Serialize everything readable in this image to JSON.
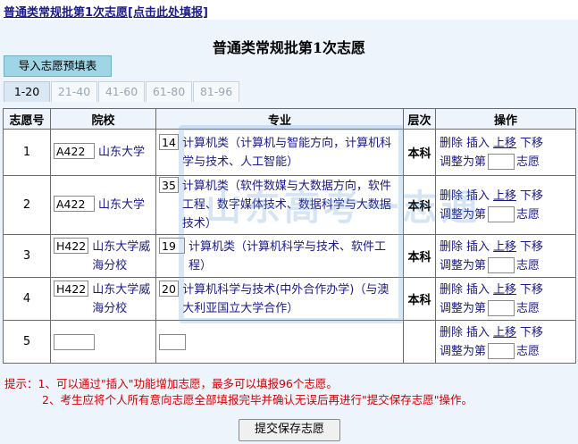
{
  "top_link": "普通类常规批第1次志愿[点击此处填报]",
  "page_title": "普通类常规批第1次志愿",
  "import_button": "导入志愿预填表",
  "tabs": [
    "1-20",
    "21-40",
    "41-60",
    "61-80",
    "81-96"
  ],
  "active_tab": "1-20",
  "table": {
    "headers": [
      "志愿号",
      "院校",
      "专业",
      "层次",
      "操作"
    ],
    "rows": [
      {
        "no": "1",
        "school_code": "A422",
        "school_name": "山东大学",
        "major_code": "14",
        "major_name": "计算机类（计算机与智能方向，计算机科学与技术、人工智能）",
        "level": "本科"
      },
      {
        "no": "2",
        "school_code": "A422",
        "school_name": "山东大学",
        "major_code": "35",
        "major_name": "计算机类（软件数媒与大数据方向，软件工程、数字媒体技术、数据科学与大数据技术）",
        "level": "本科"
      },
      {
        "no": "3",
        "school_code": "H422",
        "school_name": "山东大学威海分校",
        "major_code": "19",
        "major_name": "计算机类（计算机科学与技术、软件工程）",
        "level": "本科"
      },
      {
        "no": "4",
        "school_code": "H422",
        "school_name": "山东大学威海分校",
        "major_code": "20",
        "major_name": "计算机科学与技术(中外合作办学)（与澳大利亚国立大学合作）",
        "level": "本科"
      },
      {
        "no": "5",
        "school_code": "",
        "school_name": "",
        "major_code": "",
        "major_name": "",
        "level": ""
      }
    ],
    "ops": {
      "delete": "删除",
      "insert": "插入",
      "move_up": "上移",
      "move_down": "下移",
      "adjust_to": "调整为第",
      "unit": "志愿"
    }
  },
  "tips": {
    "line1": "提示：1、可以通过\"插入\"功能增加志愿，最多可以填报96个志愿。",
    "line2": "2、考生应将个人所有意向志愿全部填报完毕并确认无误后再进行\"提交保存志愿\"操作。"
  },
  "submit_button": "提交保存志愿",
  "watermark_text": "山东高考一志通"
}
